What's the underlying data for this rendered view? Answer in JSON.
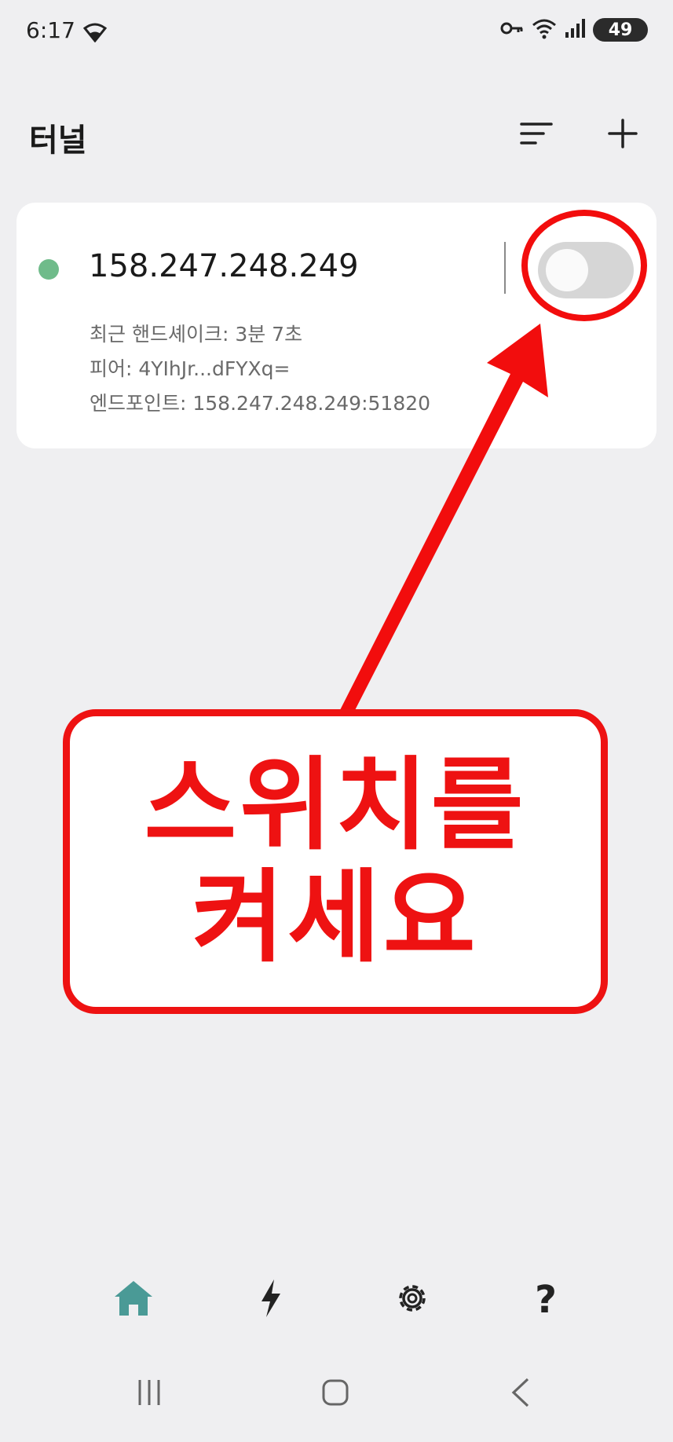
{
  "status_bar": {
    "time": "6:17",
    "battery": "49"
  },
  "header": {
    "title": "터널"
  },
  "tunnel": {
    "name": "158.247.248.249",
    "handshake": "최근 핸드셰이크: 3분 7초",
    "peer": "피어: 4YIhJr...dFYXq=",
    "endpoint": "엔드포인트: 158.247.248.249:51820",
    "enabled": false
  },
  "callout": {
    "line1": "스위치를",
    "line2": "켜세요"
  },
  "nav": {
    "help_label": "?"
  },
  "colors": {
    "accent": "#4a9a96",
    "status_dot": "#6fbb8a",
    "annotation_red": "#ee1212",
    "background": "#efeff1"
  },
  "icons": {
    "status_left": "wifi-icon",
    "status_right": [
      "key-icon",
      "wifi-icon",
      "signal-icon"
    ],
    "header": [
      "sort-icon",
      "add-icon"
    ],
    "nav": [
      "home-icon",
      "bolt-icon",
      "gear-icon",
      "help-icon"
    ],
    "system": [
      "recents-icon",
      "home-button-icon",
      "back-icon"
    ]
  }
}
